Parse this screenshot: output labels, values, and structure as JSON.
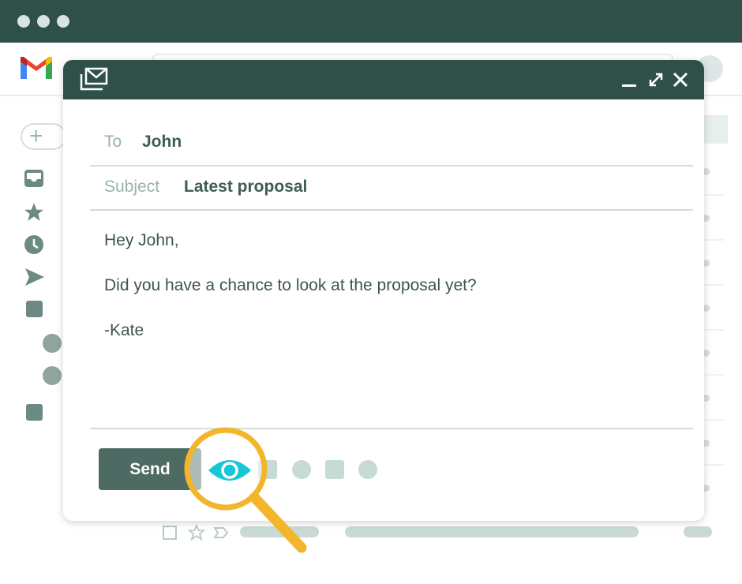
{
  "colors": {
    "header": "#2f5049",
    "accent_eye": "#17c7d6",
    "magnifier": "#f2b52b",
    "send": "#4d6a63"
  },
  "app": {
    "logo": "gmail-logo"
  },
  "compose": {
    "to_label": "To",
    "to_value": "John",
    "subject_label": "Subject",
    "subject_value": "Latest proposal",
    "body": [
      "Hey John,",
      "Did you have a chance to look at the proposal yet?",
      "-Kate"
    ],
    "send_label": "Send"
  },
  "icons": [
    "mail-compose-icon",
    "minimize-icon",
    "expand-icon",
    "close-icon",
    "eye-icon",
    "magnifier-icon"
  ]
}
